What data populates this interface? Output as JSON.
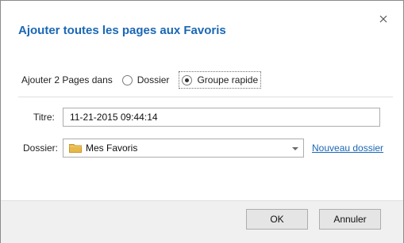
{
  "dialog": {
    "title": "Ajouter toutes les pages aux Favoris",
    "close_icon": "close-icon"
  },
  "add_row": {
    "label": "Ajouter 2 Pages dans",
    "options": [
      {
        "label": "Dossier",
        "checked": false
      },
      {
        "label": "Groupe rapide",
        "checked": true
      }
    ]
  },
  "form": {
    "title_label": "Titre:",
    "title_value": "11-21-2015 09:44:14",
    "folder_label": "Dossier:",
    "folder_value": "Mes Favoris",
    "folder_icon": "folder-icon",
    "new_folder_link": "Nouveau dossier"
  },
  "footer": {
    "ok_label": "OK",
    "cancel_label": "Annuler"
  },
  "colors": {
    "accent": "#1a67b5",
    "footer_bg": "#f0f0f0",
    "folder": "#e8b84a"
  }
}
